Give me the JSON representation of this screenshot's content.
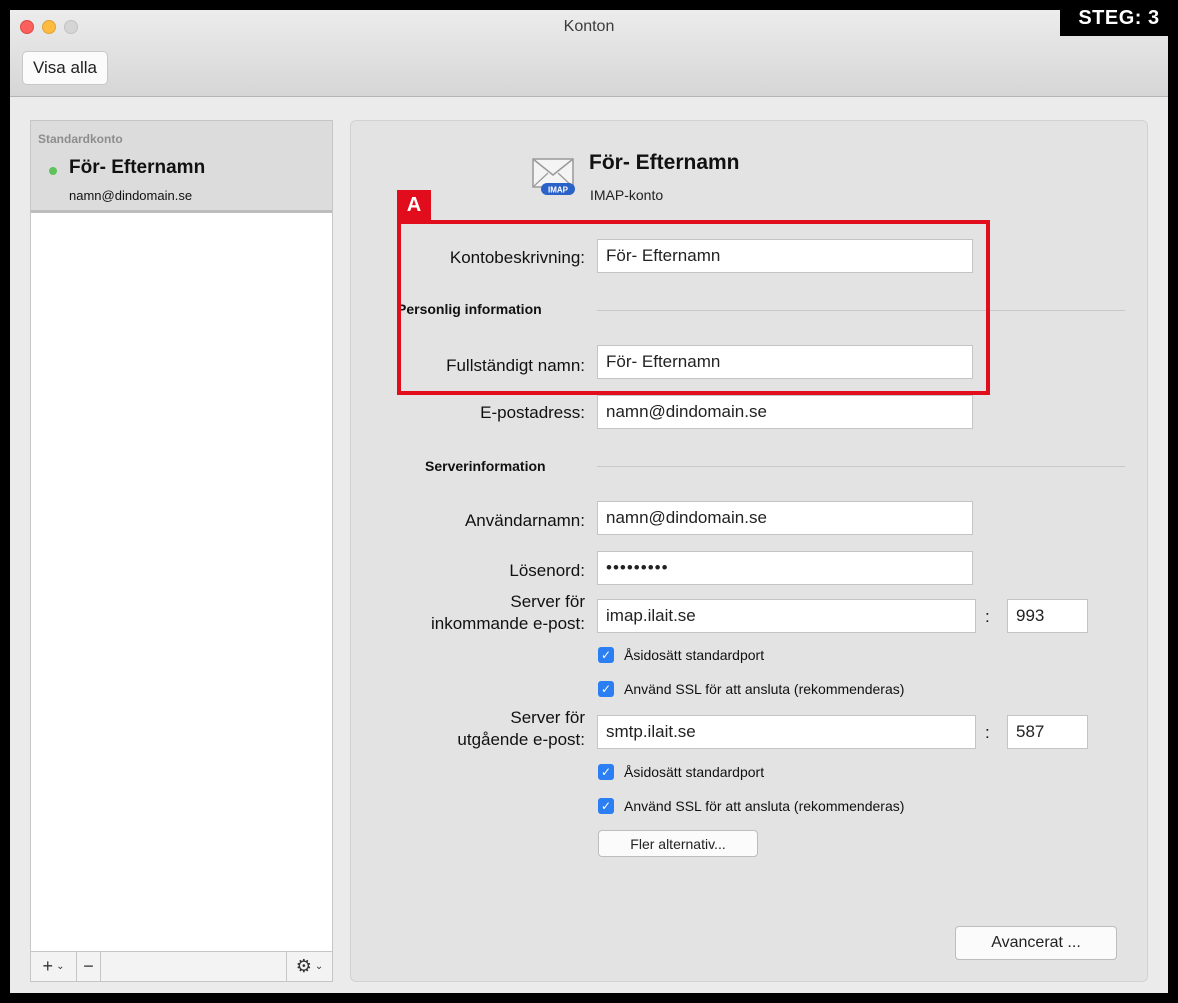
{
  "window": {
    "title": "Konton",
    "show_all_label": "Visa alla"
  },
  "step_badge": "STEG: 3",
  "sidebar": {
    "group_label": "Standardkonto",
    "account_name": "För- Efternamn",
    "account_email": "namn@dindomain.se",
    "status_color": "#5ec35a",
    "toolbar": {
      "add_icon": "plus-icon",
      "remove_icon": "minus-icon",
      "gear_icon": "gear-icon"
    }
  },
  "header": {
    "name": "För- Efternamn",
    "type": "IMAP-konto",
    "icon": "imap-mail-icon",
    "icon_badge": "IMAP"
  },
  "annotation": {
    "tag": "A",
    "color": "#e20d1c"
  },
  "form": {
    "description_label": "Kontobeskrivning:",
    "description_value": "För- Efternamn",
    "personal_section": "Personlig information",
    "fullname_label": "Fullständigt namn:",
    "fullname_value": "För- Efternamn",
    "email_label": "E-postadress:",
    "email_value": "namn@dindomain.se",
    "server_section": "Serverinformation",
    "username_label": "Användarnamn:",
    "username_value": "namn@dindomain.se",
    "password_label": "Lösenord:",
    "password_value": "•••••••••",
    "incoming_label_1": "Server för",
    "incoming_label_2": "inkommande e-post:",
    "incoming_server": "imap.ilait.se",
    "incoming_port": "993",
    "incoming_override": "Åsidosätt standardport",
    "incoming_ssl": "Använd SSL för att ansluta (rekommenderas)",
    "outgoing_label_1": "Server för",
    "outgoing_label_2": "utgående e-post:",
    "outgoing_server": "smtp.ilait.se",
    "outgoing_port": "587",
    "outgoing_override": "Åsidosätt standardport",
    "outgoing_ssl": "Använd SSL för att ansluta (rekommenderas)",
    "more_options": "Fler alternativ...",
    "advanced": "Avancerat ...",
    "colon": ":",
    "check_glyph": "✓"
  }
}
